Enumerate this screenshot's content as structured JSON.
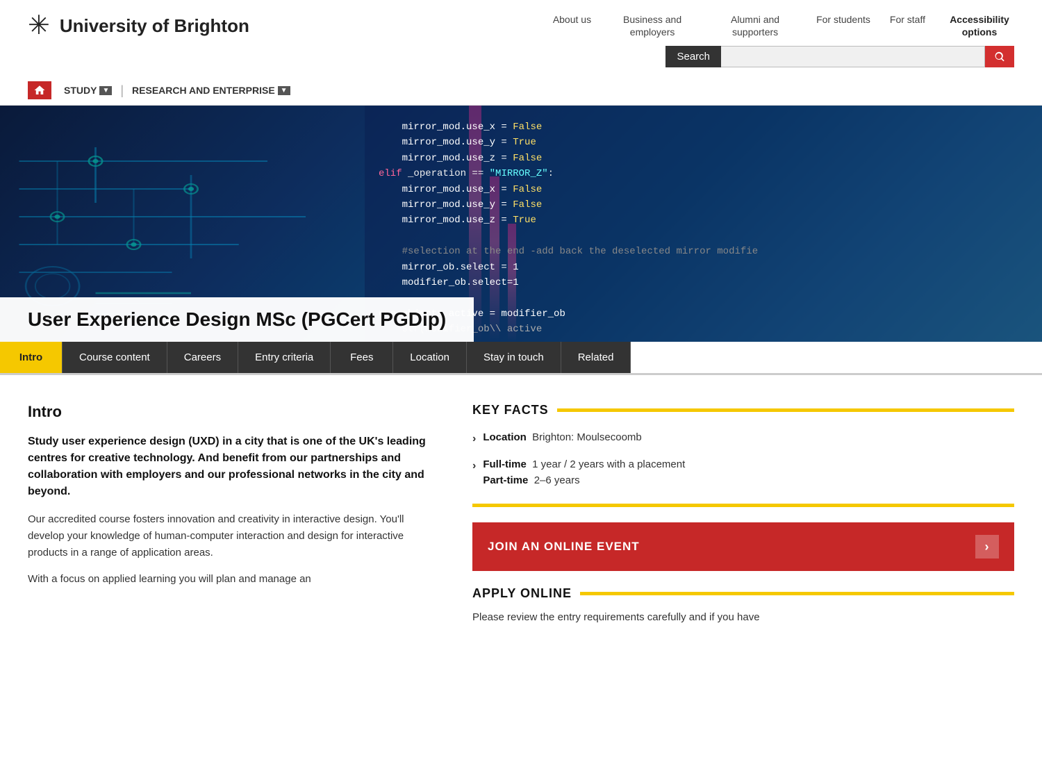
{
  "header": {
    "logo_text": "University of Brighton",
    "nav_items": [
      {
        "id": "about",
        "label": "About us"
      },
      {
        "id": "business",
        "label": "Business and employers"
      },
      {
        "id": "alumni",
        "label": "Alumni and supporters"
      },
      {
        "id": "students",
        "label": "For students"
      },
      {
        "id": "staff",
        "label": "For staff"
      },
      {
        "id": "accessibility",
        "label": "Accessibility options"
      }
    ],
    "search_label": "Search",
    "search_placeholder": ""
  },
  "secondary_nav": {
    "items": [
      {
        "id": "study",
        "label": "STUDY"
      },
      {
        "id": "research",
        "label": "RESEARCH AND ENTERPRISE"
      }
    ]
  },
  "page": {
    "title": "User Experience Design MSc (PGCert PGDip)"
  },
  "tabs": [
    {
      "id": "intro",
      "label": "Intro",
      "active": true
    },
    {
      "id": "course-content",
      "label": "Course content",
      "active": false
    },
    {
      "id": "careers",
      "label": "Careers",
      "active": false
    },
    {
      "id": "entry-criteria",
      "label": "Entry criteria",
      "active": false
    },
    {
      "id": "fees",
      "label": "Fees",
      "active": false
    },
    {
      "id": "location",
      "label": "Location",
      "active": false
    },
    {
      "id": "stay-in-touch",
      "label": "Stay in touch",
      "active": false
    },
    {
      "id": "related",
      "label": "Related",
      "active": false
    }
  ],
  "content": {
    "intro_heading": "Intro",
    "intro_bold": "Study user experience design (UXD) in a city that is one of the UK's leading centres for creative technology. And benefit from our partnerships and collaboration with employers and our professional networks in the city and beyond.",
    "intro_para1": "Our accredited course fosters innovation and creativity in interactive design. You'll develop your knowledge of human-computer interaction and design for interactive products in a range of application areas.",
    "intro_para2": "With a focus on applied learning you will plan and manage an"
  },
  "key_facts": {
    "heading": "KEY FACTS",
    "items": [
      {
        "id": "location",
        "label": "Location",
        "value": "Brighton: Moulsecoomb"
      },
      {
        "id": "duration",
        "label": "Full-time",
        "value": "1 year / 2 years with a placement",
        "label2": "Part-time",
        "value2": "2–6 years"
      }
    ]
  },
  "join_event": {
    "label": "JOIN AN ONLINE EVENT"
  },
  "apply_online": {
    "heading": "APPLY ONLINE",
    "text": "Please review the entry requirements carefully and if you have"
  },
  "hero": {
    "code_lines": [
      "    mirror_mod.use_x = False",
      "    mirror_mod.use_y = True",
      "    mirror_mod.use_z = False",
      "elif _operation == \"MIRROR_Z\":",
      "    mirror_mod.use_x = False",
      "    mirror_mod.use_y = False",
      "    mirror_mod.use_z = True",
      "",
      "    #selection at the end -add back the deselected mirror modifier",
      "    mirror_ob.select = 1",
      "    modifier_ob.select=1",
      "",
      "ene.objects.active = modifier_ob",
      "    str(modifier_ob\\ active"
    ]
  }
}
